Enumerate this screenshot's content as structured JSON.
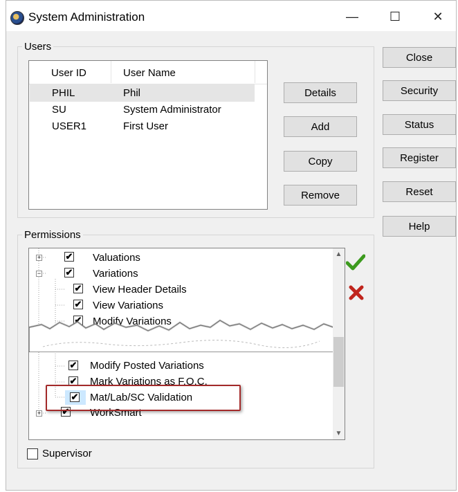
{
  "window": {
    "title": "System Administration",
    "minimize": "—",
    "maximize": "☐",
    "close": "✕"
  },
  "users": {
    "group_label": "Users",
    "columns": [
      "User ID",
      "User Name"
    ],
    "rows": [
      {
        "id": "PHIL",
        "name": "Phil",
        "selected": true
      },
      {
        "id": "SU",
        "name": "System Administrator",
        "selected": false
      },
      {
        "id": "USER1",
        "name": "First User",
        "selected": false
      }
    ],
    "buttons": {
      "details": "Details",
      "add": "Add",
      "copy": "Copy",
      "remove": "Remove"
    }
  },
  "side_buttons": {
    "close": "Close",
    "security": "Security",
    "status": "Status",
    "register": "Register",
    "reset": "Reset",
    "help": "Help"
  },
  "permissions": {
    "group_label": "Permissions",
    "tree": [
      {
        "label": "Valuations",
        "checked": true,
        "expander": "+"
      },
      {
        "label": "Variations",
        "checked": true,
        "expander": "−"
      },
      {
        "label": "View Header Details",
        "checked": true
      },
      {
        "label": "View Variations",
        "checked": true
      },
      {
        "label": "Modify Variations",
        "checked": true
      },
      {
        "label": "Modify Posted Variations",
        "checked": true
      },
      {
        "label": "Mark Variations as F.O.C.",
        "checked": true
      },
      {
        "label": "Mat/Lab/SC Validation",
        "checked": true
      },
      {
        "label": "WorkSmart",
        "checked": true,
        "expander": "+"
      }
    ],
    "accept_icon": "green-check-icon",
    "reject_icon": "red-x-icon",
    "accept_color": "#3c9a1e",
    "reject_color": "#c0241c",
    "highlight_color": "#a32a2a"
  },
  "supervisor": {
    "label": "Supervisor",
    "checked": false
  }
}
